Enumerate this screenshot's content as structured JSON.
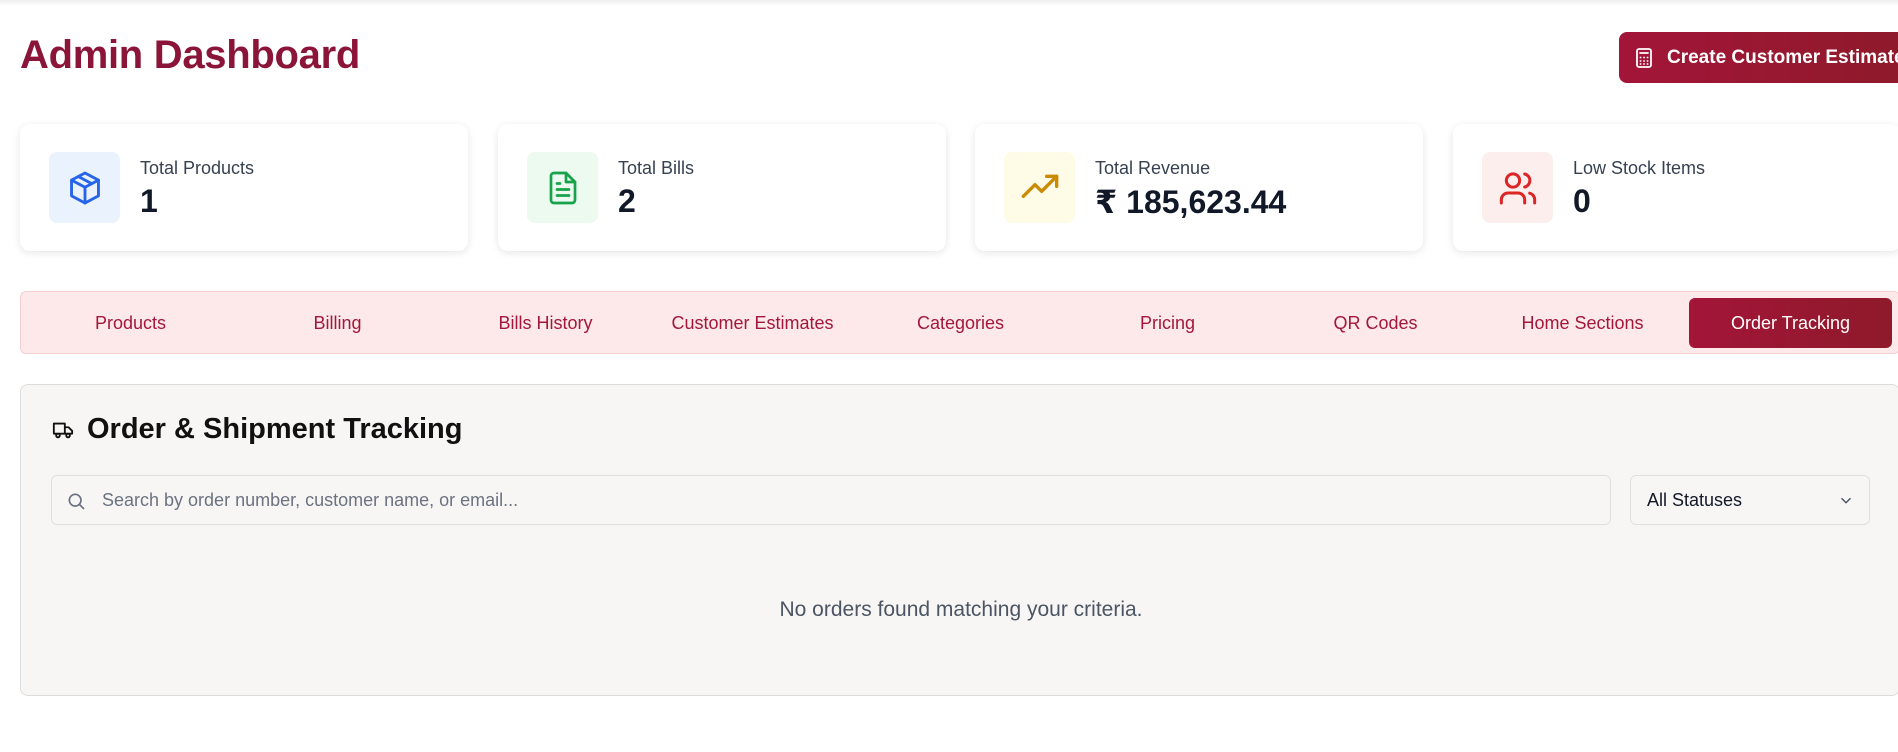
{
  "header": {
    "title": "Admin Dashboard",
    "create_estimate_label": "Create Customer Estimate"
  },
  "stats": [
    {
      "label": "Total Products",
      "value": "1",
      "icon": "box-icon",
      "color": "#2563eb"
    },
    {
      "label": "Total Bills",
      "value": "2",
      "icon": "file-text-icon",
      "color": "#16a34a"
    },
    {
      "label": "Total Revenue",
      "value": "₹ 185,623.44",
      "icon": "trending-up-icon",
      "color": "#ca8a04"
    },
    {
      "label": "Low Stock Items",
      "value": "0",
      "icon": "users-icon",
      "color": "#dc2626"
    }
  ],
  "tabs": [
    {
      "label": "Products",
      "active": false
    },
    {
      "label": "Billing",
      "active": false
    },
    {
      "label": "Bills History",
      "active": false
    },
    {
      "label": "Customer Estimates",
      "active": false
    },
    {
      "label": "Categories",
      "active": false
    },
    {
      "label": "Pricing",
      "active": false
    },
    {
      "label": "QR Codes",
      "active": false
    },
    {
      "label": "Home Sections",
      "active": false
    },
    {
      "label": "Order Tracking",
      "active": true
    }
  ],
  "tracking": {
    "title": "Order & Shipment Tracking",
    "icon": "truck-icon",
    "search_placeholder": "Search by order number, customer name, or email...",
    "search_value": "",
    "status_filter": "All Statuses",
    "empty_message": "No orders found matching your criteria."
  },
  "colors": {
    "brand": "#8a1538",
    "accent_gradient_start": "#a31539",
    "accent_gradient_end": "#8e1a2a",
    "tab_bar_bg": "#fde9ea"
  }
}
